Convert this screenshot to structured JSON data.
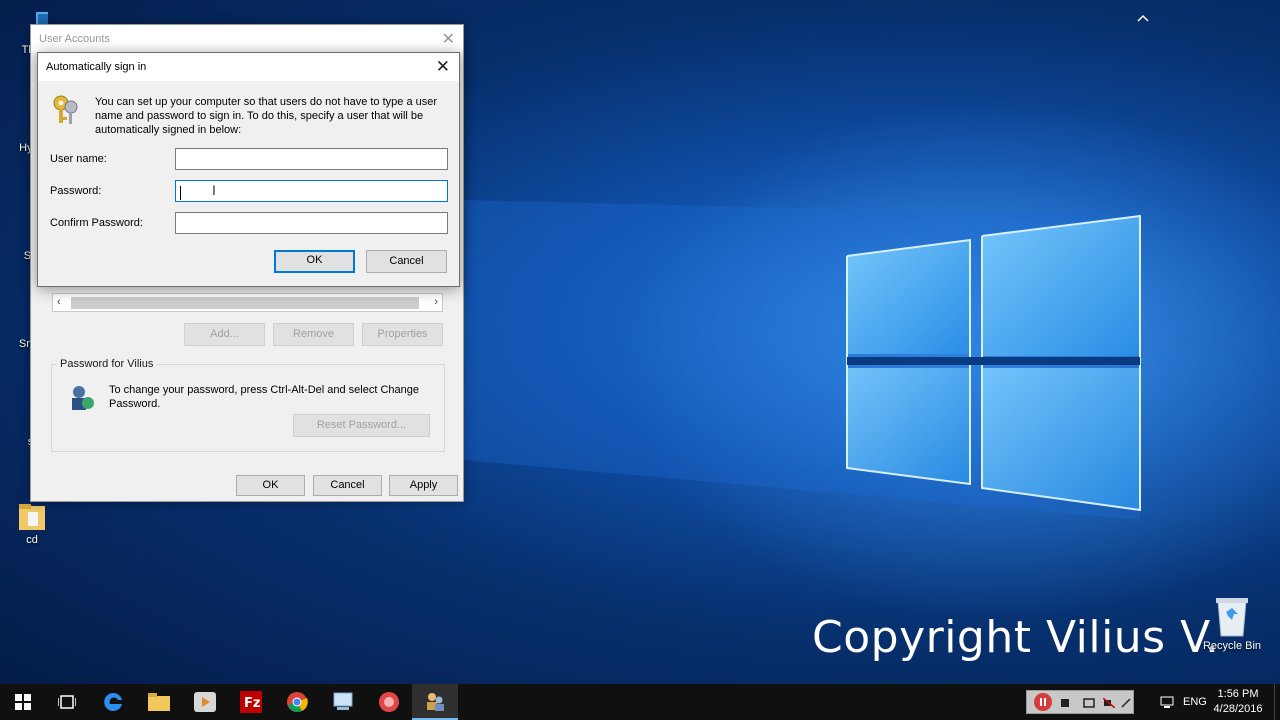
{
  "desktop": {
    "icons": [
      {
        "label": "This"
      },
      {
        "label": "Hype"
      },
      {
        "label": "Ste"
      },
      {
        "label": "Smar"
      },
      {
        "label": "st"
      },
      {
        "label": "cd"
      }
    ],
    "recycle_bin": "Recycle Bin",
    "watermark": "Copyright Vilius V."
  },
  "user_accounts": {
    "title": "User Accounts",
    "buttons": {
      "add": "Add...",
      "remove": "Remove",
      "properties": "Properties"
    },
    "password_group": {
      "title": "Password for Vilius",
      "text": "To change your password, press Ctrl-Alt-Del and select Change Password.",
      "reset": "Reset Password..."
    },
    "footer": {
      "ok": "OK",
      "cancel": "Cancel",
      "apply": "Apply"
    }
  },
  "autosignin": {
    "title": "Automatically sign in",
    "description": "You can set up your computer so that users do not have to type a user name and password to sign in. To do this, specify a user that will be automatically signed in below:",
    "fields": {
      "username": {
        "label": "User name:",
        "value": ""
      },
      "password": {
        "label": "Password:",
        "value": ""
      },
      "confirm": {
        "label": "Confirm Password:",
        "value": ""
      }
    },
    "ok": "OK",
    "cancel": "Cancel"
  },
  "taskbar": {
    "language": "ENG",
    "time": "1:56 PM",
    "date": "4/28/2016"
  }
}
